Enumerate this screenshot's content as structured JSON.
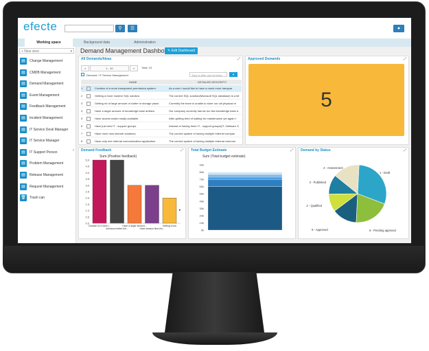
{
  "app": {
    "logo": "efecte",
    "user_icon": "user-icon"
  },
  "tabs": [
    {
      "label": "Working space",
      "active": true
    },
    {
      "label": "Background data",
      "active": false
    },
    {
      "label": "Administration",
      "active": false
    }
  ],
  "sidebar": {
    "new_view": "+ New view",
    "items": [
      {
        "label": "Change Management"
      },
      {
        "label": "CMDB Management"
      },
      {
        "label": "Demand Management"
      },
      {
        "label": "Event Management"
      },
      {
        "label": "Feedback Management"
      },
      {
        "label": "Incident Management"
      },
      {
        "label": "IT Service Desk Manager"
      },
      {
        "label": "IT Service Manager"
      },
      {
        "label": "IT Support Person"
      },
      {
        "label": "Problem Management"
      },
      {
        "label": "Release Management"
      },
      {
        "label": "Request Management"
      },
      {
        "label": "Trash can"
      }
    ]
  },
  "dashboard": {
    "title": "Demand Management Dashboard",
    "edit_label": "✎ Edit Dashboard"
  },
  "demands_panel": {
    "title": "All Demands/Ideas",
    "pager": {
      "first": "«",
      "range": "1 - 10",
      "next": "»",
      "total": "Total: 15"
    },
    "view": "Demand / IT Service Management",
    "filter_placeholder": "Type in filter and hit enter",
    "columns": {
      "name": "NAME",
      "desc": "DETAILED DESCRIPTI"
    },
    "rows": [
      {
        "n": "1",
        "name": "Creation of a more transparent permission system.",
        "desc": "As a user I would like to have a much more transpar"
      },
      {
        "n": "2",
        "name": "Getting a more modern SQL solution.",
        "desc": "The current SQL solution(Microsoft SQL database) is a bit"
      },
      {
        "n": "3",
        "name": "Getting rid of large amount of clutter in storage place.",
        "desc": "Currently the team is unable to store our old physical re"
      },
      {
        "n": "4",
        "name": "Have a larger amount of knowledge base articles.",
        "desc": "Our company currently has far too few knowledge base a"
      },
      {
        "n": "5",
        "name": "Have access easier easily available.",
        "desc": "After getting tired of waiting for maintenance yet again f"
      },
      {
        "n": "6",
        "name": "Have just new IT - support groups.",
        "desc": "Instead of having three IT - support groups(IT, Software S"
      },
      {
        "n": "7",
        "name": "Have more new internet solutions.",
        "desc": "The current system of having multiple internet compan"
      },
      {
        "n": "8",
        "name": "Have only one internal communication application.",
        "desc": "The current system of having multiple internal commun"
      }
    ]
  },
  "approved_panel": {
    "title": "Approved Demands",
    "value": "5"
  },
  "feedback_panel": {
    "title": "Demand Feedback"
  },
  "budget_panel": {
    "title": "Total Budget Estimate"
  },
  "status_panel": {
    "title": "Demand by Status"
  },
  "chart_data": [
    {
      "type": "bar",
      "title": "Sum (Positive feedback)",
      "categories": [
        "Creation of a more t...",
        "Introduce better tim...",
        "Have a larger amount...",
        "Have session time-lim...",
        "Getting a bon"
      ],
      "values": [
        5,
        5,
        3,
        3,
        2
      ],
      "colors": [
        "#c2185b",
        "#424242",
        "#f4793b",
        "#7b3f8c",
        "#f8b83a"
      ],
      "ylim": [
        0,
        5
      ],
      "yticks": [
        "0.0",
        "0.5",
        "1.0",
        "1.5",
        "2.0",
        "2.5",
        "3.0",
        "3.5",
        "4.0",
        "4.5",
        "5.0"
      ]
    },
    {
      "type": "bar",
      "title": "Sum (Total budget estimate)",
      "stacked": true,
      "values": [
        60,
        10,
        3,
        3,
        2,
        2
      ],
      "colors": [
        "#1c5a85",
        "#2e7fc0",
        "#4a9de0",
        "#7bb5e4",
        "#a9cdea",
        "#d0e3f2"
      ],
      "ylim": [
        0,
        90
      ],
      "yticks": [
        "0k",
        "10k",
        "20k",
        "30k",
        "40k",
        "50k",
        "60k",
        "70k",
        "80k",
        "90k"
      ]
    },
    {
      "type": "pie",
      "slices": [
        {
          "label": "1 - Draft",
          "value": 30,
          "color": "#2ba6c8"
        },
        {
          "label": "5 - Pending approval",
          "value": 20,
          "color": "#8dbf3c"
        },
        {
          "label": "6 - Approved",
          "value": 14,
          "color": "#1b5f7e"
        },
        {
          "label": "2 - Qualified",
          "value": 10,
          "color": "#cfe03c"
        },
        {
          "label": "3 - Published",
          "value": 11,
          "color": "#1e7fa0"
        },
        {
          "label": "4 - Assessment",
          "value": 15,
          "color": "#e9e1c4"
        }
      ]
    }
  ]
}
